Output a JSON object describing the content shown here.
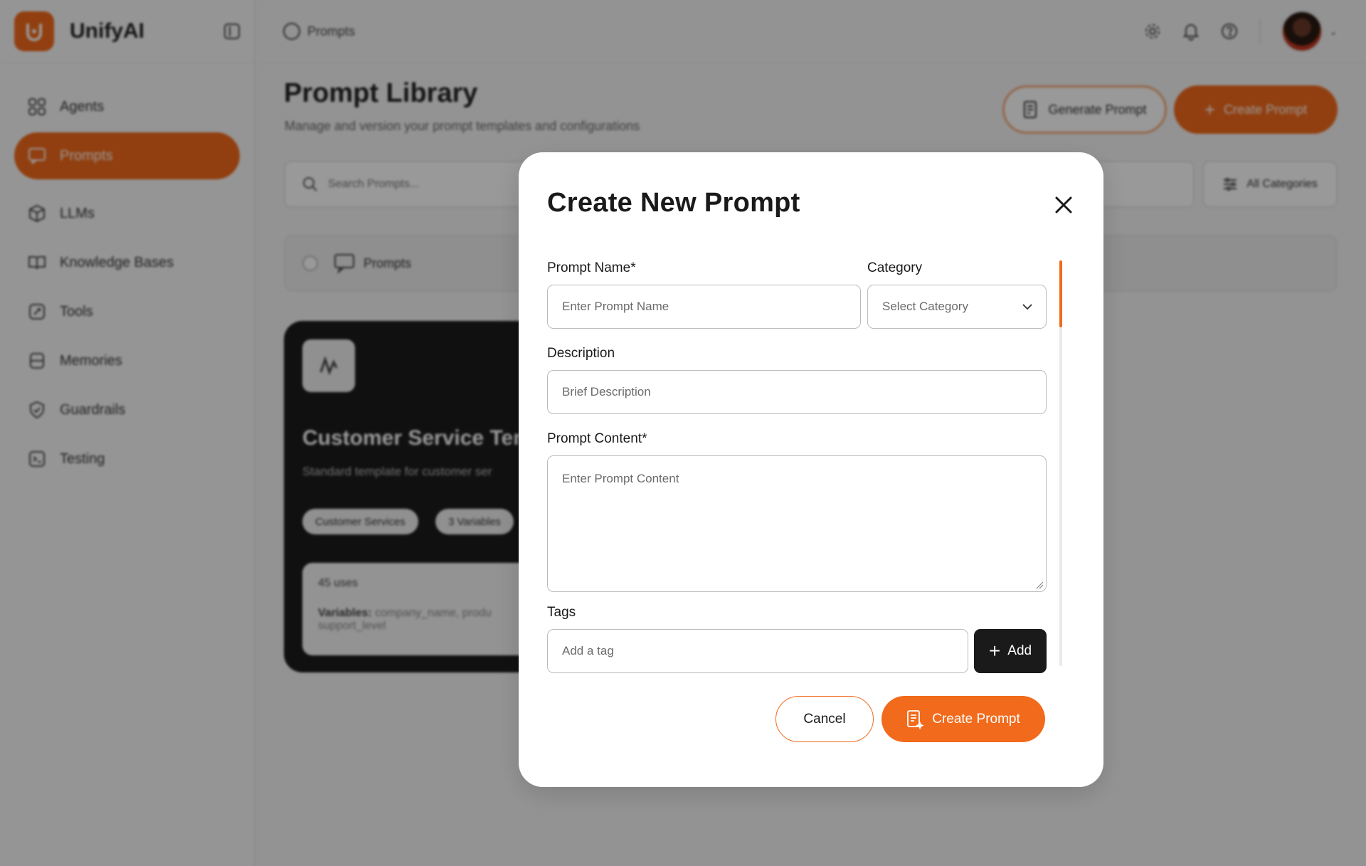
{
  "app": {
    "name": "UnifyAI"
  },
  "sidebar": {
    "items": [
      {
        "label": "Agents",
        "icon": "grid-icon"
      },
      {
        "label": "Prompts",
        "icon": "chat-icon",
        "active": true
      },
      {
        "label": "LLMs",
        "icon": "cube-icon"
      },
      {
        "label": "Knowledge Bases",
        "icon": "book-icon"
      },
      {
        "label": "Tools",
        "icon": "wrench-icon"
      },
      {
        "label": "Memories",
        "icon": "database-icon"
      },
      {
        "label": "Guardrails",
        "icon": "shield-icon"
      },
      {
        "label": "Testing",
        "icon": "test-icon"
      }
    ]
  },
  "topbar": {
    "breadcrumb": "Prompts"
  },
  "page": {
    "title": "Prompt Library",
    "subtitle": "Manage and version your prompt templates and configurations",
    "generate_label": "Generate Prompt",
    "create_label": "Create Prompt",
    "search_placeholder": "Search Prompts...",
    "filter_label": "All Categories",
    "tab_label": "Prompts"
  },
  "card": {
    "title": "Customer Service Tem",
    "description": "Standard template for customer ser",
    "chips": [
      "Customer Services",
      "3 Variables"
    ],
    "uses": "45 uses",
    "variables_label": "Variables:",
    "variables_value": "company_name, produ",
    "variables_value_2": "support_level"
  },
  "modal": {
    "title": "Create New Prompt",
    "prompt_name_label": "Prompt Name*",
    "prompt_name_placeholder": "Enter Prompt Name",
    "category_label": "Category",
    "category_placeholder": "Select Category",
    "description_label": "Description",
    "description_placeholder": "Brief Description",
    "content_label": "Prompt Content*",
    "content_placeholder": "Enter Prompt Content",
    "tags_label": "Tags",
    "tags_placeholder": "Add a tag",
    "add_label": "Add",
    "cancel_label": "Cancel",
    "create_label": "Create Prompt"
  },
  "colors": {
    "accent": "#f26a1b",
    "dark": "#1a1a1a",
    "overlay": "rgba(0,0,0,0.40)"
  }
}
